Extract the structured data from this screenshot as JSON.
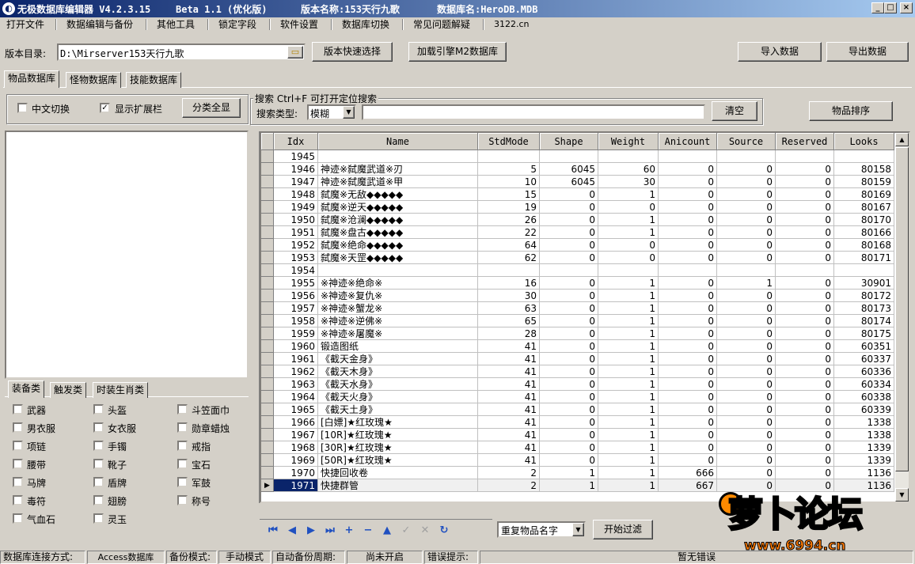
{
  "title": {
    "app": "无极数据库编辑器 V4.2.3.15",
    "beta": "Beta 1.1 (优化版)",
    "version_label": "版本名称:153天行九歌",
    "db_label": "数据库名:HeroDB.MDB"
  },
  "menu": [
    "打开文件",
    "数据编辑与备份",
    "其他工具",
    "锁定字段",
    "软件设置",
    "数据库切换",
    "常见问题解疑",
    "3122.cn"
  ],
  "toolbar": {
    "dir_label": "版本目录:",
    "dir_value": "D:\\Mirserver153天行九歌",
    "quick_select": "版本快速选择",
    "load_m2": "加载引擎M2数据库",
    "import": "导入数据",
    "export": "导出数据"
  },
  "tabs": [
    "物品数据库",
    "怪物数据库",
    "技能数据库"
  ],
  "options": {
    "chinese_toggle": "中文切换",
    "chinese_checked": false,
    "show_ext": "显示扩展栏",
    "show_ext_checked": true,
    "show_all": "分类全显"
  },
  "search": {
    "caption": "搜索  Ctrl+F 可打开定位搜索",
    "type_label": "搜索类型:",
    "type_value": "模糊",
    "clear": "清空",
    "sort": "物品排序"
  },
  "category_tabs": [
    "装备类",
    "触发类",
    "时装生肖类"
  ],
  "categories": [
    [
      "武器",
      "头盔",
      "斗笠面巾"
    ],
    [
      "男衣服",
      "女衣服",
      "勋章蜡烛"
    ],
    [
      "项链",
      "手镯",
      "戒指"
    ],
    [
      "腰带",
      "靴子",
      "宝石"
    ],
    [
      "马牌",
      "盾牌",
      "军鼓"
    ],
    [
      "毒符",
      "翅膀",
      "称号"
    ],
    [
      "气血石",
      "灵玉"
    ]
  ],
  "grid": {
    "columns": [
      "Idx",
      "Name",
      "StdMode",
      "Shape",
      "Weight",
      "Anicount",
      "Source",
      "Reserved",
      "Looks"
    ],
    "rows": [
      [
        "1945",
        "",
        "",
        "",
        "",
        "",
        "",
        "",
        ""
      ],
      [
        "1946",
        "神迹※弑魔武道※刃",
        "5",
        "6045",
        "60",
        "0",
        "0",
        "0",
        "80158"
      ],
      [
        "1947",
        "神迹※弑魔武道※甲",
        "10",
        "6045",
        "30",
        "0",
        "0",
        "0",
        "80159"
      ],
      [
        "1948",
        "弑魔※无敌◆◆◆◆◆",
        "15",
        "0",
        "1",
        "0",
        "0",
        "0",
        "80169"
      ],
      [
        "1949",
        "弑魔※逆天◆◆◆◆◆",
        "19",
        "0",
        "0",
        "0",
        "0",
        "0",
        "80167"
      ],
      [
        "1950",
        "弑魔※沧澜◆◆◆◆◆",
        "26",
        "0",
        "1",
        "0",
        "0",
        "0",
        "80170"
      ],
      [
        "1951",
        "弑魔※盘古◆◆◆◆◆",
        "22",
        "0",
        "1",
        "0",
        "0",
        "0",
        "80166"
      ],
      [
        "1952",
        "弑魔※绝命◆◆◆◆◆",
        "64",
        "0",
        "0",
        "0",
        "0",
        "0",
        "80168"
      ],
      [
        "1953",
        "弑魔※天罡◆◆◆◆◆",
        "62",
        "0",
        "0",
        "0",
        "0",
        "0",
        "80171"
      ],
      [
        "1954",
        "",
        "",
        "",
        "",
        "",
        "",
        "",
        ""
      ],
      [
        "1955",
        "※神迹※绝命※",
        "16",
        "0",
        "1",
        "0",
        "1",
        "0",
        "30901"
      ],
      [
        "1956",
        "※神迹※复仇※",
        "30",
        "0",
        "1",
        "0",
        "0",
        "0",
        "80172"
      ],
      [
        "1957",
        "※神迹※蟹龙※",
        "63",
        "0",
        "1",
        "0",
        "0",
        "0",
        "80173"
      ],
      [
        "1958",
        "※神迹※逆佛※",
        "65",
        "0",
        "1",
        "0",
        "0",
        "0",
        "80174"
      ],
      [
        "1959",
        "※神迹※屠魔※",
        "28",
        "0",
        "1",
        "0",
        "0",
        "0",
        "80175"
      ],
      [
        "1960",
        "锻造图纸",
        "41",
        "0",
        "1",
        "0",
        "0",
        "0",
        "60351"
      ],
      [
        "1961",
        "《截天金身》",
        "41",
        "0",
        "1",
        "0",
        "0",
        "0",
        "60337"
      ],
      [
        "1962",
        "《截天木身》",
        "41",
        "0",
        "1",
        "0",
        "0",
        "0",
        "60336"
      ],
      [
        "1963",
        "《截天水身》",
        "41",
        "0",
        "1",
        "0",
        "0",
        "0",
        "60334"
      ],
      [
        "1964",
        "《截天火身》",
        "41",
        "0",
        "1",
        "0",
        "0",
        "0",
        "60338"
      ],
      [
        "1965",
        "《截天土身》",
        "41",
        "0",
        "1",
        "0",
        "0",
        "0",
        "60339"
      ],
      [
        "1966",
        "[白嫖]★红玫瑰★",
        "41",
        "0",
        "1",
        "0",
        "0",
        "0",
        "1338"
      ],
      [
        "1967",
        "[10R]★红玫瑰★",
        "41",
        "0",
        "1",
        "0",
        "0",
        "0",
        "1338"
      ],
      [
        "1968",
        "[30R]★红玫瑰★",
        "41",
        "0",
        "1",
        "0",
        "0",
        "0",
        "1339"
      ],
      [
        "1969",
        "[50R]★红玫瑰★",
        "41",
        "0",
        "1",
        "0",
        "0",
        "0",
        "1339"
      ],
      [
        "1970",
        "快捷回收卷",
        "2",
        "1",
        "1",
        "666",
        "0",
        "0",
        "1136"
      ],
      [
        "1971",
        "快捷群管",
        "2",
        "1",
        "1",
        "667",
        "0",
        "0",
        "1136"
      ]
    ],
    "selected_index": 26
  },
  "nav": {
    "icons": [
      "first-icon",
      "prev-icon",
      "next-icon",
      "last-icon",
      "plus-icon",
      "minus-icon",
      "up-icon",
      "check-icon",
      "cross-icon",
      "refresh-icon"
    ],
    "filter_value": "重复物品名字",
    "filter_button": "开始过滤"
  },
  "statusbar": {
    "conn_label": "数据库连接方式:",
    "conn_value": "Access数据库",
    "backup_label": "备份模式:",
    "backup_value": "手动模式",
    "auto_label": "自动备份周期:",
    "auto_value": "尚未开启",
    "error_label": "错误提示:",
    "error_value": "暂无错误"
  },
  "watermark": {
    "logo": "萝卜论坛",
    "site": "www.6994.cn"
  },
  "colors": {
    "title_start": "#0a246a",
    "title_end": "#a6caf0",
    "selected_row": "#0a246a",
    "nav_icon": "#2050c0"
  }
}
